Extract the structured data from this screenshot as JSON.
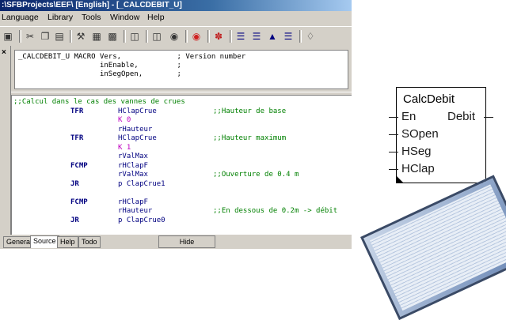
{
  "window": {
    "title": ":\\SFBProjects\\EEF\\ [English] - [_CALCDEBIT_U]"
  },
  "menu": [
    "Language",
    "Library",
    "Tools",
    "Window",
    "Help"
  ],
  "toolbar_icons": [
    "save-icon",
    "cut-icon",
    "copy-icon",
    "paste-icon",
    "build-icon",
    "open-icon",
    "properties-icon",
    "window-icon",
    "monitor-icon",
    "globe-icon",
    "stop-icon",
    "debug-icon",
    "align-left-icon",
    "align-center-icon",
    "align-right-icon",
    "list-icon",
    "eraser-icon"
  ],
  "declaration": {
    "lines": [
      "_CALCDEBIT_U MACRO Vers,             ; Version number",
      "                   inEnable,         ;",
      "                   inSegOpen,        ;"
    ]
  },
  "code": {
    "lines": [
      {
        "text": ";;Calcul dans le cas des vannes de crues",
        "color": "#008000"
      },
      {
        "op": "TFR",
        "arg": "HClapCrue",
        "comment": ";;Hauteur de base"
      },
      {
        "op": "",
        "arg": "K 0",
        "argcolor": "#c000c0"
      },
      {
        "op": "",
        "arg": "rHauteur"
      },
      {
        "op": "TFR",
        "arg": "HClapCrue",
        "comment": ";;Hauteur maximum"
      },
      {
        "op": "",
        "arg": "K 1",
        "argcolor": "#c000c0"
      },
      {
        "op": "",
        "arg": "rValMax"
      },
      {
        "op": "FCMP",
        "arg": "rHClapF"
      },
      {
        "op": "",
        "arg": "rValMax",
        "comment": ";;Ouverture de 0.4 m"
      },
      {
        "op": "JR",
        "arg": "p ClapCrue1"
      },
      {
        "op": "",
        "arg": ""
      },
      {
        "op": "FCMP",
        "arg": "rHClapF"
      },
      {
        "op": "",
        "arg": "rHauteur",
        "comment": ";;En dessous de 0.2m -> débit"
      },
      {
        "op": "JR",
        "arg": "p ClapCrue0"
      }
    ]
  },
  "tabs": [
    "General",
    "Source",
    "Help",
    "Todo"
  ],
  "active_tab": "Source",
  "hide_button": "Hide",
  "function_block": {
    "name": "CalcDebit",
    "inputs": [
      "En",
      "SOpen",
      "HSeg",
      "HClap"
    ],
    "outputs": [
      "Debit"
    ]
  },
  "colors": {
    "keyword": "#000080",
    "comment": "#008000",
    "constant": "#c000c0",
    "pins": "#1a1a1a"
  }
}
